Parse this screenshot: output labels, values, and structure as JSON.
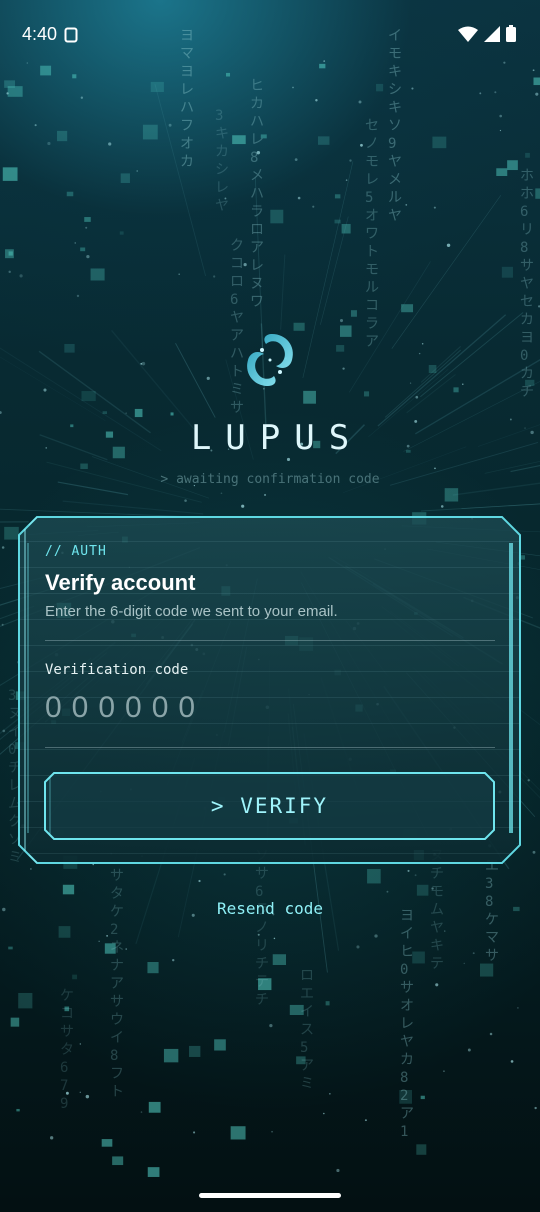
{
  "status_bar": {
    "time": "4:40"
  },
  "app": {
    "name": "LUPUS",
    "tagline": "> awaiting confirmation code"
  },
  "card": {
    "section_label": "// AUTH",
    "title": "Verify account",
    "subtitle": "Enter the 6-digit code we sent to your email.",
    "field_label": "Verification code",
    "code_placeholder": "000000",
    "verify_label": "> VERIFY"
  },
  "resend": {
    "label": "Resend code"
  },
  "icons": {
    "sim": "sim-card-icon",
    "wifi": "wifi-icon",
    "signal": "cell-signal-icon",
    "battery": "battery-icon",
    "logo": "lupus-logo-icon"
  },
  "colors": {
    "accent": "#6fe5ee",
    "card_bg": "#0c2c31",
    "card_border": "#5fd8e2",
    "background": "#061418"
  }
}
